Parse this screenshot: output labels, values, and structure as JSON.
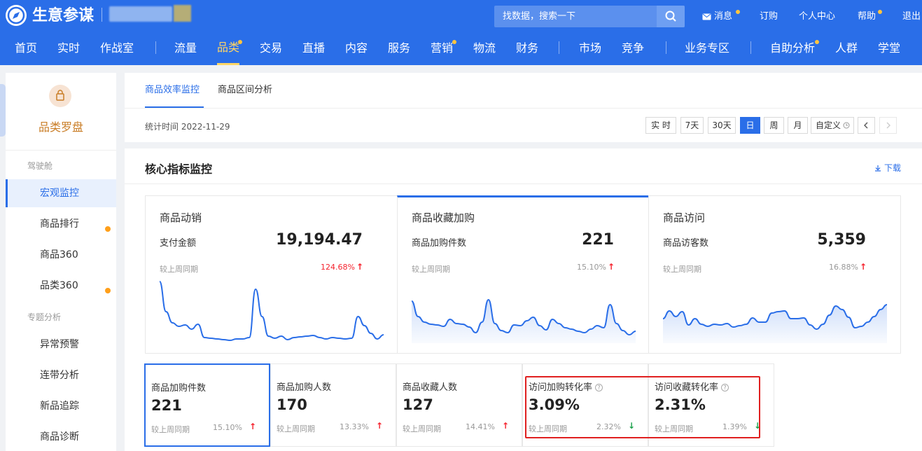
{
  "header": {
    "brand": "生意参谋",
    "search_placeholder": "找数据，搜索一下",
    "links": [
      "消息",
      "订购",
      "个人中心",
      "帮助",
      "退出"
    ]
  },
  "nav": {
    "items": [
      "首页",
      "实时",
      "作战室",
      "流量",
      "品类",
      "交易",
      "直播",
      "内容",
      "服务",
      "营销",
      "物流",
      "财务",
      "市场",
      "竞争",
      "业务专区",
      "自助分析",
      "人群",
      "学堂"
    ],
    "active": "品类"
  },
  "sidebar": {
    "title": "品类罗盘",
    "group1": "驾驶舱",
    "group2": "专题分析",
    "items": [
      "宏观监控",
      "商品排行",
      "商品360",
      "品类360",
      "异常预警",
      "连带分析",
      "新品追踪",
      "商品诊断"
    ]
  },
  "page_tabs": [
    "商品效率监控",
    "商品区间分析"
  ],
  "stat_time": "统计时间 2022-11-29",
  "period_buttons": [
    "实 时",
    "7天",
    "30天",
    "日",
    "周",
    "月",
    "自定义"
  ],
  "active_period": "日",
  "core": {
    "title": "核心指标监控",
    "download": "下载"
  },
  "big_cards": [
    {
      "title": "商品动销",
      "label": "支付金额",
      "value": "19,194.47",
      "compare_label": "较上周同期",
      "change": "124.68%",
      "trend": "up",
      "spark": [
        0.88,
        0.45,
        0.29,
        0.24,
        0.26,
        0.2,
        0.27,
        0.08,
        0.07,
        0.06,
        0.05,
        0.04,
        0.06,
        0.06,
        0.08,
        0.77,
        0.38,
        0.1,
        0.07,
        0.1,
        0.05,
        0.08,
        0.09,
        0.1,
        0.11,
        0.08,
        0.06,
        0.08,
        0.07,
        0.06,
        0.07,
        0.38,
        0.25,
        0.14,
        0.06,
        0.12
      ]
    },
    {
      "title": "商品收藏加购",
      "label": "商品加购件数",
      "value": "221",
      "compare_label": "较上周同期",
      "change": "15.10%",
      "trend": "up",
      "spark": [
        0.6,
        0.38,
        0.3,
        0.27,
        0.26,
        0.24,
        0.34,
        0.28,
        0.27,
        0.23,
        0.15,
        0.3,
        0.62,
        0.28,
        0.18,
        0.15,
        0.26,
        0.25,
        0.32,
        0.37,
        0.25,
        0.19,
        0.34,
        0.28,
        0.22,
        0.2,
        0.17,
        0.15,
        0.2,
        0.25,
        0.22,
        0.55,
        0.28,
        0.18,
        0.12,
        0.17
      ]
    },
    {
      "title": "商品访问",
      "label": "商品访客数",
      "value": "5,359",
      "compare_label": "较上周同期",
      "change": "16.88%",
      "trend": "up",
      "spark": [
        0.35,
        0.46,
        0.38,
        0.45,
        0.26,
        0.35,
        0.27,
        0.24,
        0.27,
        0.26,
        0.28,
        0.23,
        0.25,
        0.27,
        0.36,
        0.3,
        0.3,
        0.43,
        0.45,
        0.46,
        0.35,
        0.35,
        0.36,
        0.26,
        0.2,
        0.27,
        0.4,
        0.53,
        0.48,
        0.37,
        0.22,
        0.24,
        0.3,
        0.38,
        0.48,
        0.55
      ]
    }
  ],
  "small_cards": [
    {
      "title": "商品加购件数",
      "value": "221",
      "compare_label": "较上周同期",
      "change": "15.10%",
      "trend": "up",
      "help": false
    },
    {
      "title": "商品加购人数",
      "value": "170",
      "compare_label": "较上周同期",
      "change": "13.33%",
      "trend": "up",
      "help": false
    },
    {
      "title": "商品收藏人数",
      "value": "127",
      "compare_label": "较上周同期",
      "change": "14.41%",
      "trend": "up",
      "help": false
    },
    {
      "title": "访问加购转化率",
      "value": "3.09%",
      "compare_label": "较上周同期",
      "change": "2.32%",
      "trend": "down",
      "help": true
    },
    {
      "title": "访问收藏转化率",
      "value": "2.31%",
      "compare_label": "较上周同期",
      "change": "1.39%",
      "trend": "down",
      "help": true
    }
  ],
  "colors": {
    "primary": "#2a6ee8",
    "up": "#f5222d",
    "down": "#1aa04a",
    "brand_orange": "#c97d26",
    "highlight_box": "#e02020"
  }
}
